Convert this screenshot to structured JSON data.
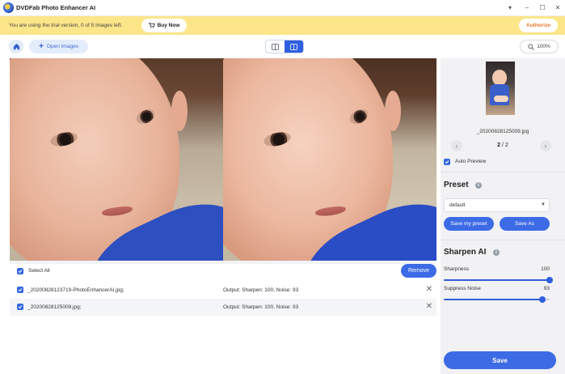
{
  "window": {
    "title": "DVDFab Photo Enhancer AI",
    "controls": {
      "menu": "▾",
      "minimize": "–",
      "maximize": "☐",
      "close": "✕"
    }
  },
  "banner": {
    "text": "You are using the trial version, 0 of 5 images left.",
    "buy_label": "Buy Now",
    "authorize_label": "Authorize",
    "color": "#fde58a"
  },
  "toolbar": {
    "open_label": "Open Images",
    "zoom": "100%"
  },
  "list": {
    "select_all_label": "Select All",
    "remove_label": "Remove",
    "rows": [
      {
        "name": "_20200828123719-PhotoEnhancerAI.jpg;",
        "info": "Output: Sharpen: 100, Noise: 93"
      },
      {
        "name": "_20200828125009.jpg;",
        "info": "Output: Sharpen: 100, Noise: 93"
      }
    ]
  },
  "panel": {
    "thumb_name": "_20200828125009.jpg",
    "pager_current": "2",
    "pager_sep": "/",
    "pager_total": "2",
    "auto_preview_label": "Auto Preview",
    "preset": {
      "title": "Preset",
      "selected": "default",
      "save_my_preset_label": "Save my preset",
      "save_as_label": "Save As"
    },
    "sharpen": {
      "title": "Sharpen AI",
      "sharpness_label": "Sharpness",
      "sharpness_value": "100",
      "sharpness_fraction": 1.0,
      "noise_label": "Suppress Noise",
      "noise_value": "93",
      "noise_fraction": 0.93
    },
    "save_label": "Save"
  },
  "colors": {
    "accent": "#3d6be6",
    "warning": "#e8792c"
  }
}
